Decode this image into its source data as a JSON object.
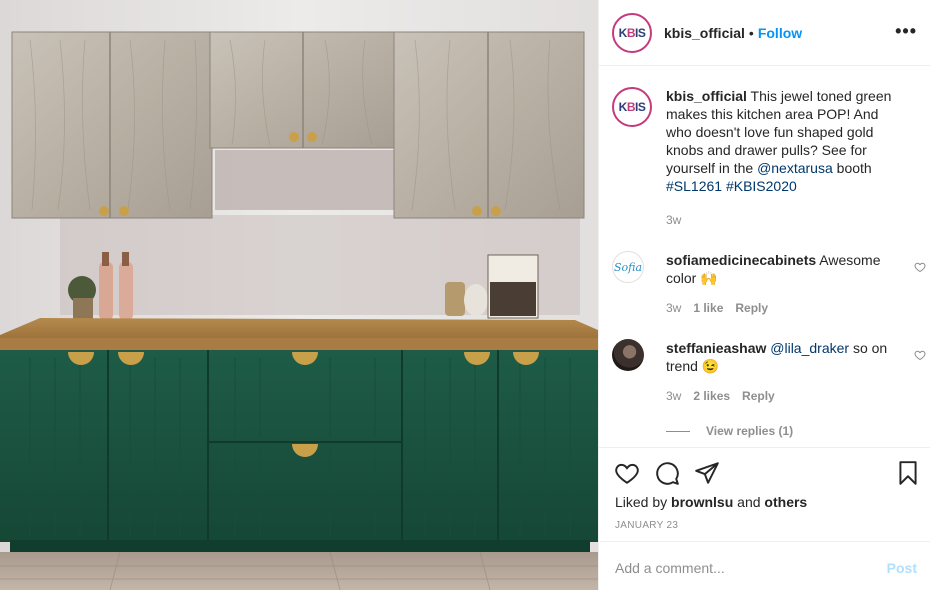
{
  "post": {
    "username": "kbis_official",
    "separator": "•",
    "follow_label": "Follow",
    "more_icon": "more-options-icon",
    "avatar_text": {
      "k": "K",
      "b": "B",
      "is": "IS"
    }
  },
  "caption": {
    "username": "kbis_official",
    "text_1": " This jewel toned green makes this kitchen area POP! And who doesn't love fun shaped gold knobs and drawer pulls? See for yourself in the ",
    "mention": "@nextarusa",
    "text_2": " booth ",
    "hashtag_1": "#SL1261",
    "hashtag_2": "#KBIS2020",
    "time": "3w"
  },
  "comments": [
    {
      "username": "sofiamedicinecabinets",
      "text": " Awesome color 🙌",
      "time": "3w",
      "likes": "1 like",
      "reply_label": "Reply",
      "avatar_text": "Sofia"
    },
    {
      "username": "steffanieashaw",
      "mention": "@lila_draker",
      "text": " so on trend 😉",
      "time": "3w",
      "likes": "2 likes",
      "reply_label": "Reply"
    }
  ],
  "view_replies_label": "View replies (1)",
  "actions": {
    "liked_by_prefix": "Liked by ",
    "liked_by_user": "brownlsu",
    "liked_by_mid": " and ",
    "liked_by_others": "others",
    "date": "JANUARY 23"
  },
  "add_comment": {
    "placeholder": "Add a comment...",
    "post_label": "Post"
  },
  "colors": {
    "accent_blue": "#0095f6",
    "link_blue": "#00376b",
    "muted": "#8e8e8e",
    "cabinet_green": "#1d5a45",
    "gold": "#c9a04a"
  }
}
